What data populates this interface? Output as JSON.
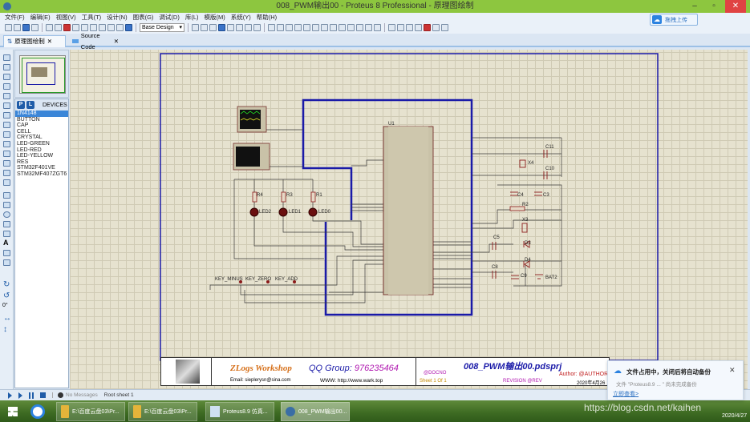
{
  "window": {
    "title": "008_PWM输出00 - Proteus 8 Professional - 原理图绘制",
    "minimize": "–",
    "maximize": "▫",
    "close": "✕"
  },
  "menu": [
    "文件(F)",
    "编辑(E)",
    "视图(V)",
    "工具(T)",
    "设计(N)",
    "图表(G)",
    "调试(D)",
    "库(L)",
    "模版(M)",
    "系统(Y)",
    "帮助(H)"
  ],
  "toolbar": {
    "design_select": "Base Design",
    "design_arrow": "▾"
  },
  "baidu": {
    "icon": "baidu-cloud-icon",
    "label": "拖拽上传"
  },
  "tabs": [
    {
      "label": "原理图绘制",
      "close": "✕",
      "active": true
    },
    {
      "label": "Source Code",
      "close": "✕",
      "active": false
    }
  ],
  "devices": {
    "p": "P",
    "l": "L",
    "header": "DEVICES",
    "items": [
      "1N4148",
      "BUTTON",
      "CAP",
      "CELL",
      "CRYSTAL",
      "LED-GREEN",
      "LED-RED",
      "LED-YELLOW",
      "RES",
      "STM32F401VE",
      "STM32MF407ZGT6"
    ],
    "selected": 0
  },
  "left_tools": {
    "rotation": "0°"
  },
  "schematic": {
    "labels": [
      "U1",
      "R4",
      "R3",
      "R1",
      "LED2",
      "LED1",
      "LED0",
      "KEY_MINUS",
      "KEY_ZERO",
      "KEY_ADD",
      "X4",
      "C11",
      "C10",
      "C4",
      "C3",
      "R2",
      "X3",
      "C5",
      "D3",
      "D4",
      "C8",
      "C9",
      "BAT2"
    ],
    "wire_color": "#2b2b2b",
    "bus_color": "#1a1aa8",
    "part_color": "#8b1a1a"
  },
  "titleblock": {
    "logo": "ZLogs Workshop",
    "qq": "QQ Group: ",
    "qq_num": "976235464",
    "email": "Email: sieplerysn@sina.com",
    "www": "WWW: http://www.wark.top",
    "project": "008_PWM输出00.pdsprj",
    "docno": "@DOCNO",
    "sheet": "Sheet 1",
    "of": "Of 1",
    "revision": "REVISION @REV",
    "author": "Author: @AUTHOR",
    "date": "2020年4月26"
  },
  "status": {
    "messages": "No Messages",
    "sheet": "Root sheet 1"
  },
  "taskbar": {
    "items": [
      "E:\\百度云盘03\\Pr...",
      "E:\\百度云盘03\\Pr...",
      "Proteus8.9 仿真...",
      "008_PWM输出00..."
    ],
    "watermark": "https://blog.csdn.net/kaihen",
    "date": "2020/4/27"
  },
  "toast": {
    "title": "文件占用中，关闭后将自动备份",
    "body": "文件 \"Proteus8.9 ... \" 尚未完成备份",
    "link": "立即查看>",
    "close": "✕"
  }
}
